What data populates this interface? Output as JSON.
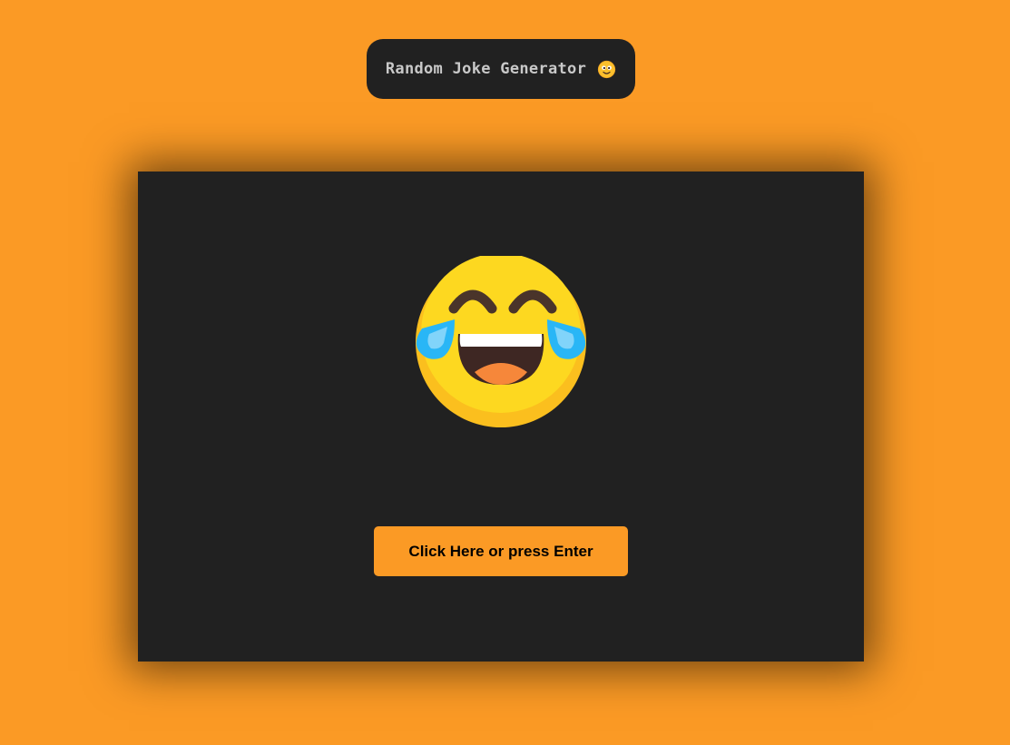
{
  "header": {
    "title": "Random Joke Generator",
    "title_icon": "smiling-face-emoji"
  },
  "card": {
    "emoji_icon": "tears-of-joy-emoji",
    "button_label": "Click Here or press Enter"
  },
  "colors": {
    "background": "#fb9a25",
    "card": "#212121",
    "button": "#fb9a25",
    "title_text": "#c9c9c9"
  }
}
